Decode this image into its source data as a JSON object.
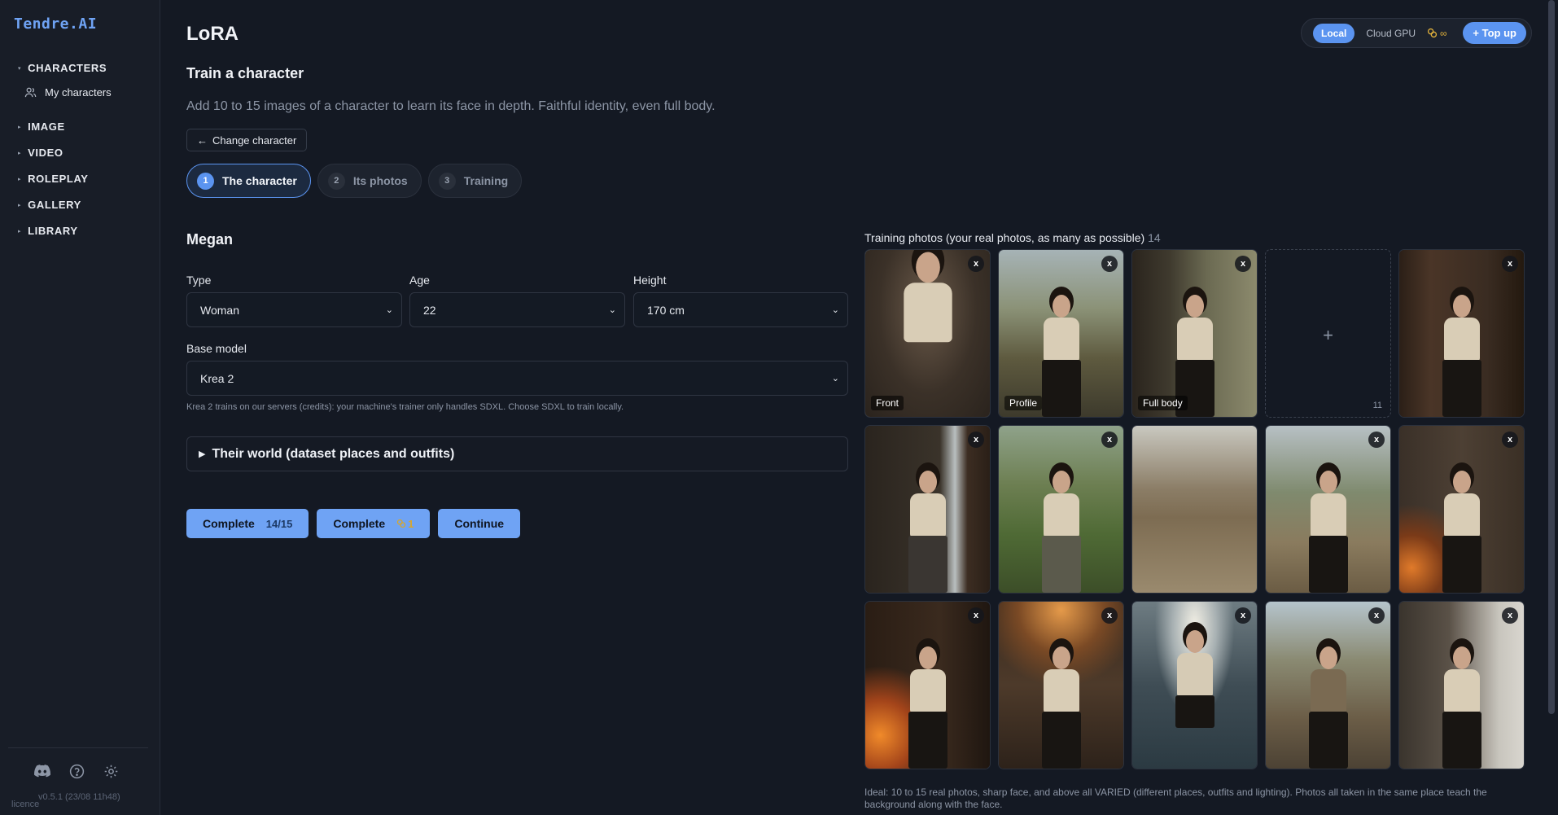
{
  "brand": "Tendre.AI",
  "sidebar": {
    "sections": [
      {
        "label": "CHARACTERS"
      },
      {
        "label": "IMAGE"
      },
      {
        "label": "VIDEO"
      },
      {
        "label": "ROLEPLAY"
      },
      {
        "label": "GALLERY"
      },
      {
        "label": "LIBRARY"
      }
    ],
    "sub_item": "My characters",
    "version": "v0.5.1 (23/08 11h48)",
    "licence": "licence",
    "footer_icons": [
      "discord-icon",
      "help-icon",
      "gear-icon"
    ]
  },
  "header": {
    "title": "LoRA",
    "section_title": "Train a character",
    "description": "Add 10 to 15 images of a character to learn its face in depth. Faithful identity, even full body.",
    "change_character": "Change character"
  },
  "top_bar": {
    "local": "Local",
    "cloud": "Cloud GPU",
    "credits": "∞",
    "top_up": "Top up"
  },
  "steps": [
    {
      "num": "1",
      "label": "The character"
    },
    {
      "num": "2",
      "label": "Its photos"
    },
    {
      "num": "3",
      "label": "Training"
    }
  ],
  "form": {
    "name": "Megan",
    "type_label": "Type",
    "type_value": "Woman",
    "age_label": "Age",
    "age_value": "22",
    "height_label": "Height",
    "height_value": "170 cm",
    "base_model_label": "Base model",
    "base_model_value": "Krea 2",
    "hint": "Krea 2 trains on our servers (credits): your machine's trainer only handles SDXL. Choose SDXL to train locally.",
    "world_label": "Their world (dataset places and outfits)"
  },
  "actions": {
    "complete1_label": "Complete",
    "complete1_badge": "14/15",
    "complete2_label": "Complete",
    "complete2_badge": "1",
    "continue_label": "Continue"
  },
  "gallery": {
    "title": "Training photos (your real photos, as many as possible)",
    "count": "14",
    "add_remaining": "11",
    "tags": {
      "front": "Front",
      "profile": "Profile",
      "full_body": "Full body"
    },
    "note": "Ideal: 10 to 15 real photos, sharp face, and above all VARIED (different places, outfits and lighting). Photos all taken in the same place teach the background along with the face."
  },
  "colors": {
    "accent": "#5b94f0",
    "button": "#6fa3f4",
    "background": "#141923",
    "sidebar": "#181d27",
    "credit": "#e2b23c"
  }
}
